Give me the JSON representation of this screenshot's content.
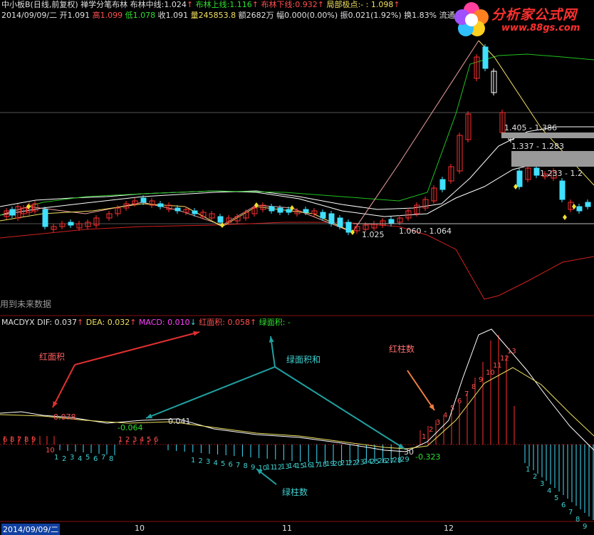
{
  "price_header": {
    "name": "中小板B(日线,前复权)",
    "indicator": "禅学分笔布林",
    "mid_label": "布林中线:",
    "mid_value": "1.024",
    "up_label": "布林上线:",
    "up_value": "1.116",
    "low_label": "布林下线:",
    "low_value": "0.932",
    "local_label": "局部极点:",
    "local_value": "- : 1.098"
  },
  "quote": {
    "date": "2014/09/09/二",
    "open": "开1.091",
    "high": "高1.099",
    "low": "低1.078",
    "close": "收1.091",
    "volume": "量245853.8",
    "amount": "额2682万",
    "change": "幅0.000(0.00%)",
    "amplitude": "振0.021(1.92%)",
    "turnover": "换1.83% 流通"
  },
  "logo": {
    "title": "分析家公式网",
    "url": "www.88gs.com"
  },
  "price_annotations": {
    "low_point": "1.025",
    "range1": "1.060 - 1.064",
    "range2": "1.405 - 1.386",
    "range3": "1.337 - 1.283",
    "range4": "1.233 - 1.2",
    "future_note": "用到未来数据"
  },
  "macd_header": {
    "title": "MACDYX",
    "dif": "DIF: 0.037",
    "dea": "DEA: 0.032",
    "macd": "MACD: 0.010",
    "red_area": "红面积: 0.058",
    "green_area": "绿面积: -"
  },
  "macd_annotations": {
    "v1": "0.078",
    "v2": "-0.064",
    "v3": "0.041",
    "v4": "-0.323",
    "v4_count": "30",
    "callout_red_area": "红面积",
    "callout_green_sum": "绿面积和",
    "callout_red_count": "红柱数",
    "callout_green_count": "绿柱数"
  },
  "macd_bar_numbers": {
    "left_red": [
      "6",
      "8",
      "7",
      "8",
      "9"
    ],
    "left_red_tail": [
      "1",
      "2",
      "3",
      "4",
      "5",
      "6"
    ],
    "green_run1": [
      "1",
      "2",
      "3",
      "4",
      "5",
      "6",
      "7",
      "8"
    ],
    "green_run2": [
      "1",
      "2",
      "3",
      "4",
      "5",
      "6",
      "7",
      "8",
      "9",
      "10",
      "11",
      "12",
      "13",
      "14",
      "15",
      "16",
      "17",
      "18",
      "19",
      "20",
      "21",
      "22",
      "23",
      "24",
      "25",
      "26",
      "27",
      "28",
      "29"
    ],
    "red_run": [
      "1",
      "2",
      "3",
      "4",
      "5",
      "6",
      "7",
      "8",
      "9",
      "10",
      "11",
      "12",
      "13"
    ],
    "green_run3": [
      "1",
      "2",
      "3",
      "4",
      "5",
      "6",
      "7",
      "8",
      "9"
    ],
    "marker_10": "10",
    "marker_11": "11"
  },
  "x_axis": {
    "date": "2014/09/09/二",
    "ticks": [
      "10",
      "11",
      "12"
    ]
  },
  "colors": {
    "background": "#000000",
    "up_candle": "#ff3030",
    "down_candle": "#40e0ff",
    "upper_band": "#20c020",
    "lower_band": "#d02020",
    "mid_band": "#ffffff",
    "dif_line": "#ffffff",
    "dea_line": "#f0e060"
  }
}
